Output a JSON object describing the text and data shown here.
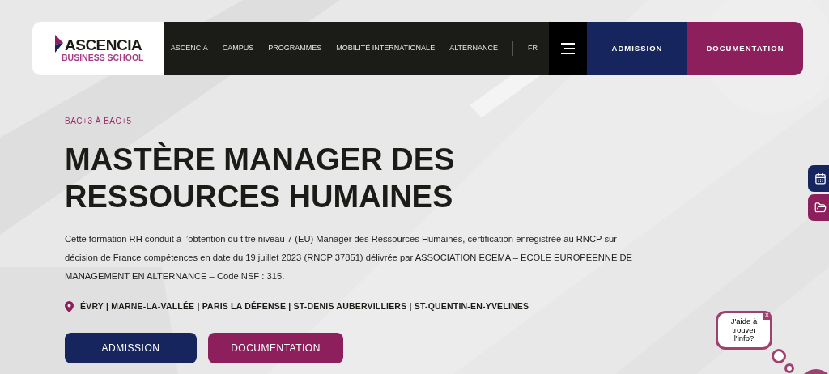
{
  "header": {
    "logo": {
      "name": "ASCENCIA",
      "subtitle": "BUSINESS SCHOOL"
    },
    "nav": [
      {
        "label": "ASCENCIA"
      },
      {
        "label": "CAMPUS"
      },
      {
        "label": "PROGRAMMES"
      },
      {
        "label": "MOBILITÉ INTERNATIONALE"
      },
      {
        "label": "ALTERNANCE"
      }
    ],
    "language": "FR",
    "buttons": [
      {
        "label": "ADMISSION",
        "kind": "primary"
      },
      {
        "label": "DOCUMENTATION",
        "kind": "secondary"
      }
    ]
  },
  "hero": {
    "tag": "BAC+3 À BAC+5",
    "title": [
      "MASTÈRE MANAGER DES",
      "RESSOURCES HUMAINES"
    ],
    "description": "Cette formation RH conduit à l’obtention du titre niveau 7 (EU) Manager des Ressources Humaines, certification enregistrée au RNCP sur décision de France compétences en date du 19 juillet 2023 (RNCP 37851) délivrée par ASSOCIATION ECEMA – ECOLE EUROPEENNE DE MANAGEMENT EN ALTERNANCE – Code NSF : 315.",
    "locations": "ÉVRY | MARNE-LA-VALLÉE | PARIS LA DÉFENSE | ST-DENIS AUBERVILLIERS | ST-QUENTIN-EN-YVELINES",
    "buttons": [
      {
        "label": "ADMISSION",
        "kind": "primary"
      },
      {
        "label": "DOCUMENTATION",
        "kind": "secondary"
      }
    ]
  },
  "side_buttons": [
    {
      "kind": "primary"
    },
    {
      "kind": "secondary"
    }
  ],
  "chat": {
    "bubble": "J'aide à trouver l'info?",
    "close": "×"
  }
}
